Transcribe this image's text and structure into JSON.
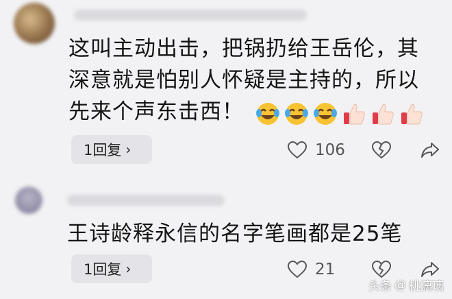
{
  "comments": [
    {
      "text": "这叫主动出击，把锅扔给王岳伦，其深意就是怕别人怀疑是主持的，所以先来个声东击西！",
      "reply_label": "1回复",
      "likes": "106"
    },
    {
      "text": "王诗龄释永信的名字笔画都是25笔",
      "reply_label": "1回复",
      "likes": "21"
    }
  ],
  "emojis": [
    "laughing-crying-emoji",
    "laughing-crying-emoji",
    "laughing-crying-emoji",
    "thumbs-up-emoji",
    "thumbs-up-emoji",
    "thumbs-up-emoji"
  ],
  "watermark": {
    "prefix": "头条",
    "handle": "桃漓璃"
  },
  "colors": {
    "background": "#f2f2f4",
    "pill": "#e4e4e8",
    "text": "#141414",
    "icon": "#555555"
  }
}
